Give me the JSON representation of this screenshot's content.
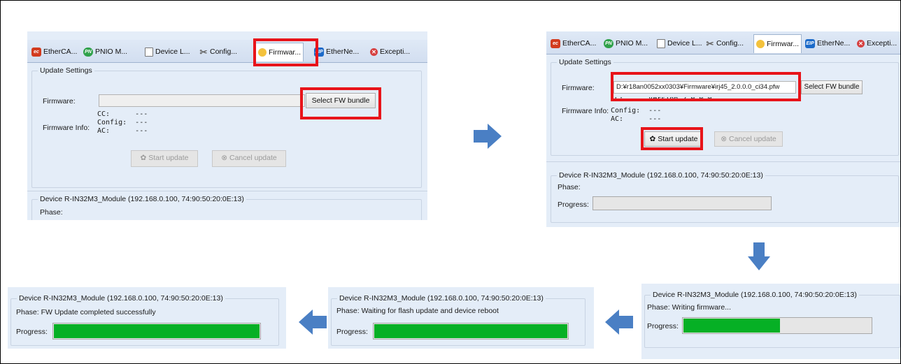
{
  "tabs": {
    "ethercat": "EtherCA...",
    "pnio": "PNIO M...",
    "device_list": "Device L...",
    "config": "Config...",
    "firmware": "Firmwar...",
    "ethernet": "EtherNe...",
    "exceptions": "Excepti...",
    "icon_pn": "PN",
    "icon_eip": "EIP"
  },
  "update_settings": {
    "title": "Update Settings",
    "firmware_label": "Firmware:",
    "select_button": "Select FW bundle",
    "firmware_info_label": "Firmware Info:",
    "info_keys_empty": "CC:      ---\nConfig:  ---\nAC:      ---",
    "info_keys_partial": "Config:  ---\nAC:      ---",
    "cc_partial": "CC:      Version 2.0.0 0",
    "firmware_path": "D:¥r18an0052xx0303¥Firmware¥irj45_2.0.0.0_ci34.pfw",
    "start_button": "Start update",
    "cancel_button": "Cancel update"
  },
  "device": {
    "title": "Device R-IN32M3_Module (192.168.0.100, 74:90:50:20:0E:13)",
    "phase_label": "Phase:",
    "progress_label": "Progress:",
    "phase_writing": "Phase: Writing firmware...",
    "phase_waiting": "Phase: Waiting for flash update and device reboot",
    "phase_completed": "Phase: FW Update completed successfully"
  },
  "progress_values": {
    "writing": 0.52,
    "waiting": 1.0,
    "completed": 1.0
  },
  "colors": {
    "highlight_red": "#e8141a",
    "progress_green": "#06b025",
    "arrow_blue": "#4a7fc4",
    "panel_bg": "#e4edf8"
  }
}
